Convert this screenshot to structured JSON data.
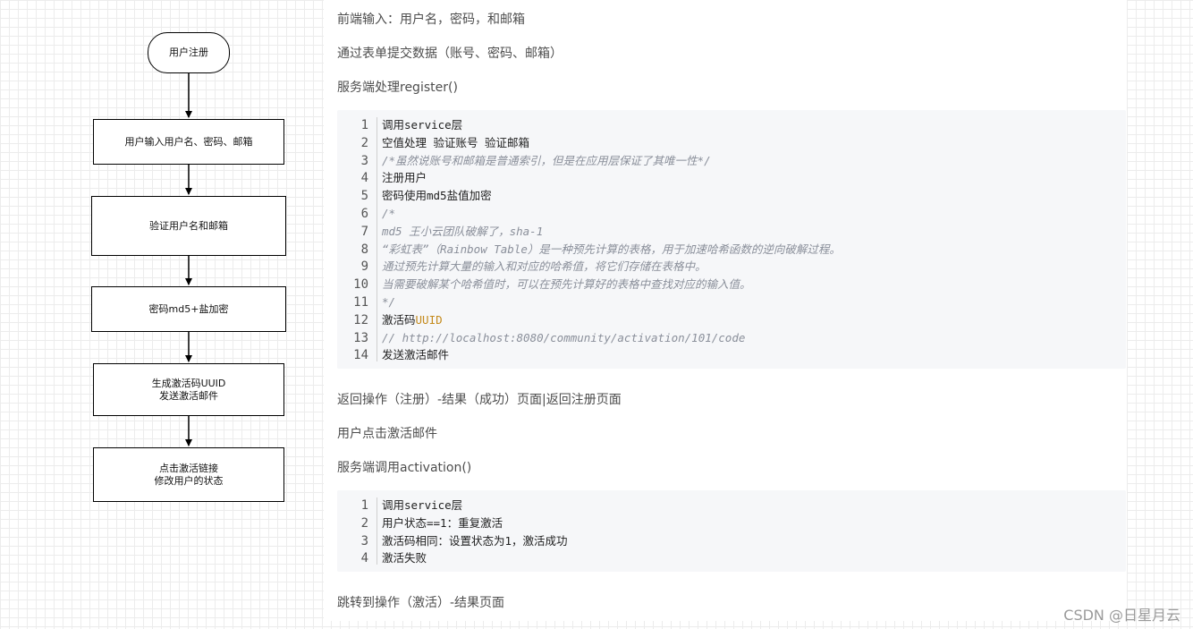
{
  "flowchart": {
    "nodes": [
      {
        "id": "start",
        "lines": [
          "用户注册"
        ]
      },
      {
        "id": "input",
        "lines": [
          "用户输入用户名、密码、邮箱"
        ]
      },
      {
        "id": "verify",
        "lines": [
          "验证用户名和邮箱"
        ]
      },
      {
        "id": "encrypt",
        "lines": [
          "密码md5+盐加密"
        ]
      },
      {
        "id": "activation-code",
        "lines": [
          "生成激活码UUID",
          "发送激活邮件"
        ]
      },
      {
        "id": "click-link",
        "lines": [
          "点击激活链接",
          "修改用户的状态"
        ]
      }
    ]
  },
  "doc": {
    "p1": "前端输入：用户名，密码，和邮箱",
    "p2": "通过表单提交数据（账号、密码、邮箱）",
    "p3": "服务端处理register()",
    "code1": [
      {
        "n": "1",
        "text": "调用service层",
        "comment": false
      },
      {
        "n": "2",
        "text": "空值处理 验证账号 验证邮箱",
        "comment": false
      },
      {
        "n": "3",
        "text": "/*虽然说账号和邮箱是普通索引，但是在应用层保证了其唯一性*/",
        "comment": true
      },
      {
        "n": "4",
        "text": "注册用户",
        "comment": false
      },
      {
        "n": "5",
        "text": "密码使用md5盐值加密",
        "comment": false
      },
      {
        "n": "6",
        "text": "/*",
        "comment": true
      },
      {
        "n": "7",
        "text": "md5 王小云团队破解了，sha-1",
        "comment": true
      },
      {
        "n": "8",
        "text": "“彩虹表”（Rainbow Table）是一种预先计算的表格，用于加速哈希函数的逆向破解过程。",
        "comment": true
      },
      {
        "n": "9",
        "text": "通过预先计算大量的输入和对应的哈希值，将它们存储在表格中。",
        "comment": true
      },
      {
        "n": "10",
        "text": "当需要破解某个哈希值时，可以在预先计算好的表格中查找对应的输入值。",
        "comment": true
      },
      {
        "n": "11",
        "text": "*/",
        "comment": true
      },
      {
        "n": "12",
        "text": "激活码",
        "kw": "UUID",
        "comment": false
      },
      {
        "n": "13",
        "text": "// http://localhost:8080/community/activation/101/code",
        "comment": true
      },
      {
        "n": "14",
        "text": "发送激活邮件",
        "comment": false
      }
    ],
    "p4": "返回操作（注册）-结果（成功）页面|返回注册页面",
    "p5": "用户点击激活邮件",
    "p6": "服务端调用activation()",
    "code2": [
      {
        "n": "1",
        "text": "调用service层",
        "comment": false
      },
      {
        "n": "2",
        "text": "用户状态==1：重复激活",
        "comment": false
      },
      {
        "n": "3",
        "text": "激活码相同：设置状态为1，激活成功",
        "comment": false
      },
      {
        "n": "4",
        "text": "激活失败",
        "comment": false
      }
    ],
    "p7": "跳转到操作（激活）-结果页面"
  },
  "watermark": "CSDN @日星月云"
}
